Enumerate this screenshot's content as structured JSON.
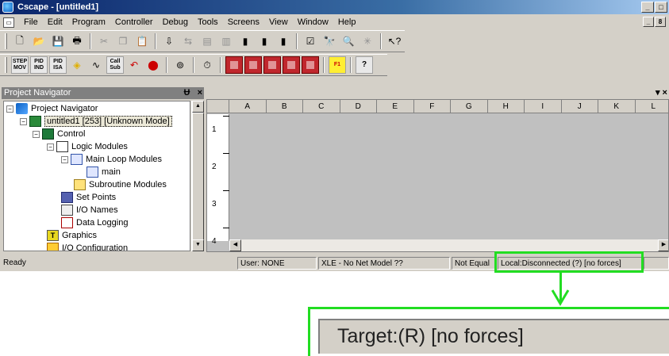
{
  "window": {
    "title": "Cscape - [untitled1]",
    "buttons": [
      "_",
      "□",
      "x"
    ],
    "mdi_buttons": [
      "_",
      "8",
      "x"
    ]
  },
  "menu": {
    "items": [
      {
        "label": "File"
      },
      {
        "label": "Edit"
      },
      {
        "label": "Program"
      },
      {
        "label": "Controller"
      },
      {
        "label": "Debug"
      },
      {
        "label": "Tools"
      },
      {
        "label": "Screens"
      },
      {
        "label": "View"
      },
      {
        "label": "Window"
      },
      {
        "label": "Help"
      }
    ]
  },
  "toolbar1": {
    "icons": [
      "new-icon",
      "open-icon",
      "save-icon",
      "print-icon",
      "cut-icon",
      "copy-icon",
      "paste-icon",
      "download-icon",
      "compare-icon",
      "insert-row-icon",
      "delete-row-icon",
      "block-icon",
      "block2-icon",
      "block3-icon",
      "verify-icon",
      "find-icon",
      "zoom-icon",
      "bug-icon",
      "context-help-icon"
    ]
  },
  "toolbar2": {
    "labels": {
      "step": "STEP\nMOV",
      "pid_ind": "PID\nIND",
      "pid_isa": "PID\nISA",
      "call_sub": "Call\nSub",
      "f1": "F1",
      "help": "?"
    }
  },
  "navigator": {
    "title": "Project Navigator",
    "pin": "Ʉ",
    "close": "×",
    "tree": [
      {
        "label": "Project Navigator",
        "expander": "−"
      },
      {
        "label": "untitled1 [253] [Unknown Mode]",
        "expander": "−"
      },
      {
        "label": "Control",
        "expander": "−"
      },
      {
        "label": "Logic Modules",
        "expander": "−"
      },
      {
        "label": "Main Loop Modules",
        "expander": "−"
      },
      {
        "label": "main"
      },
      {
        "label": "Subroutine Modules"
      },
      {
        "label": "Set Points"
      },
      {
        "label": "I/O Names"
      },
      {
        "label": "Data Logging"
      },
      {
        "label": "Graphics",
        "icon_text": "T"
      },
      {
        "label": "I/O Configuration"
      }
    ]
  },
  "editor": {
    "controls": "▾ ×",
    "columns": [
      "A",
      "B",
      "C",
      "D",
      "E",
      "F",
      "G",
      "H",
      "I",
      "J",
      "K",
      "L"
    ],
    "rows": [
      "1",
      "2",
      "3",
      "4"
    ]
  },
  "status": {
    "ready": "Ready",
    "user": "User: NONE",
    "model": "XLE - No Net Model ??",
    "equal": "Not Equal",
    "connection": "Local:Disconnected (?) [no forces]"
  },
  "callout": {
    "zoom_text": "Target:(R) [no forces]",
    "color": "#22dd22"
  }
}
